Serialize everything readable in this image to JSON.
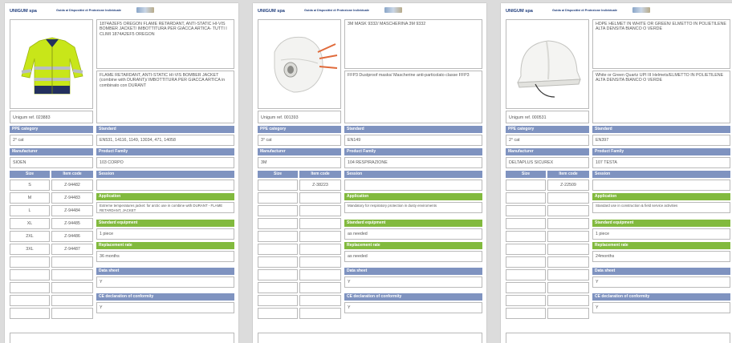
{
  "header": {
    "brand": "UNIGUM spa",
    "guide": "Guida ai Dispositivi di Protezione Individuale"
  },
  "labels": {
    "ppe_category": "PPE category",
    "standard": "Standard",
    "manufacturer": "Manufacturer",
    "product_family": "Product Family",
    "size": "Size",
    "item_code": "Item code",
    "session": "Session",
    "application": "Application",
    "standard_equipment": "Standard equipment",
    "replacement_rate": "Replacement rate",
    "data_sheet": "Data sheet",
    "ce_declaration": "CE declaration of conformity"
  },
  "pages": [
    {
      "desc_title": "1874A2EF5 OREGON FLAME RETARDANT, ANTI-STATIC HI-VIS BOMBER JACKET/ IMBOTTITURA PER GIACCA ARTICA- TUTTI I CLIMI 1874A2EF5 OREGON",
      "desc_detail": "FLAME RETARDANT, ANTI-STATIC HI-VIS BOMBER JACKET (combine with DURANT)/ IMBOTTITURA PER GIACCA ARTICA in combinato con DURANT",
      "ref": "Unigum ref. 023883",
      "ppe_category": "2° cat",
      "standard": "EN531, 14116, 1149, 13034, 471, 14058",
      "manufacturer": "SIOEN",
      "product_family": "103 CORPO",
      "session": "",
      "application": "Extreme temperatures jacket: for arctic use in combine with DURANT - FLAME RETARDANT, JACKET",
      "standard_equipment": "1 piece",
      "replacement_rate": "36 months",
      "data_sheet": "Y",
      "ce": "Y",
      "sizes": [
        {
          "size": "S",
          "code": "Z-94482"
        },
        {
          "size": "M",
          "code": "Z-94483"
        },
        {
          "size": "L",
          "code": "Z-94484"
        },
        {
          "size": "XL",
          "code": "Z-94485"
        },
        {
          "size": "2XL",
          "code": "Z-94486"
        },
        {
          "size": "3XL",
          "code": "Z-94487"
        },
        {
          "size": "",
          "code": ""
        },
        {
          "size": "",
          "code": ""
        },
        {
          "size": "",
          "code": ""
        },
        {
          "size": "",
          "code": ""
        },
        {
          "size": "",
          "code": ""
        }
      ],
      "image_icon": "hi-vis-jacket-icon"
    },
    {
      "desc_title": "3M MASK 9332/ MASCHERINA 3M 9332",
      "desc_detail": "FFP3 Dustproof masks/ Mascherine anti-particolato classe FFP3",
      "ref": "Unigum ref. 001393",
      "ppe_category": "3° cat",
      "standard": "EN149",
      "manufacturer": "3M",
      "product_family": "104 RESPIRAZIONE",
      "session": "",
      "application": "Mandatory for respiratory protection in dusty enviroments",
      "standard_equipment": "as needed",
      "replacement_rate": "as needed",
      "data_sheet": "Y",
      "ce": "Y",
      "sizes": [
        {
          "size": "",
          "code": "Z-38223"
        },
        {
          "size": "",
          "code": ""
        },
        {
          "size": "",
          "code": ""
        },
        {
          "size": "",
          "code": ""
        },
        {
          "size": "",
          "code": ""
        },
        {
          "size": "",
          "code": ""
        },
        {
          "size": "",
          "code": ""
        },
        {
          "size": "",
          "code": ""
        },
        {
          "size": "",
          "code": ""
        },
        {
          "size": "",
          "code": ""
        },
        {
          "size": "",
          "code": ""
        }
      ],
      "image_icon": "dust-mask-icon"
    },
    {
      "desc_title": "HDPE HELMET IN WHITE OR GREEN/ ELMETTO IN POLIETILENE ALTA DENSITA BIANCO O VERDE",
      "desc_detail": "White or Green Quartz UPI III Helmets/ELMETTO IN POLIETILENE ALTA DENSITA BIANCO O VERDE",
      "ref": "Unigum ref. 000531",
      "ppe_category": "2° cat",
      "standard": "EN397",
      "manufacturer": "DELTAPLUS SICUREX",
      "product_family": "107 TESTA",
      "session": "",
      "application": "Standard use in construction & field service activities",
      "standard_equipment": "1 piece",
      "replacement_rate": "24months",
      "data_sheet": "Y",
      "ce": "Y",
      "sizes": [
        {
          "size": "",
          "code": "Z-22509"
        },
        {
          "size": "",
          "code": ""
        },
        {
          "size": "",
          "code": ""
        },
        {
          "size": "",
          "code": ""
        },
        {
          "size": "",
          "code": ""
        },
        {
          "size": "",
          "code": ""
        },
        {
          "size": "",
          "code": ""
        },
        {
          "size": "",
          "code": ""
        },
        {
          "size": "",
          "code": ""
        },
        {
          "size": "",
          "code": ""
        },
        {
          "size": "",
          "code": ""
        }
      ],
      "image_icon": "safety-helmet-icon"
    }
  ]
}
